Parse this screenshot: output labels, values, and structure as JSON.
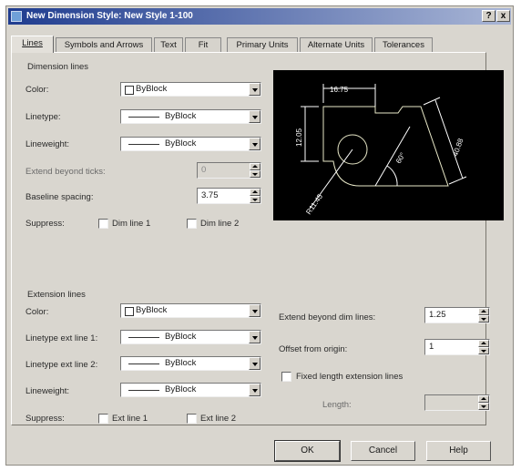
{
  "window": {
    "title": "New Dimension Style: New Style 1-100",
    "help_button": "?",
    "close_button": "x"
  },
  "tabs": [
    {
      "label": "Lines"
    },
    {
      "label": "Symbols and Arrows"
    },
    {
      "label": "Text"
    },
    {
      "label": "Fit"
    },
    {
      "label": "Primary Units"
    },
    {
      "label": "Alternate Units"
    },
    {
      "label": "Tolerances"
    }
  ],
  "dimension_lines": {
    "group_label": "Dimension lines",
    "color": {
      "label": "Color:",
      "value": "ByBlock"
    },
    "linetype": {
      "label": "Linetype:",
      "value": "ByBlock"
    },
    "lineweight": {
      "label": "Lineweight:",
      "value": "ByBlock"
    },
    "extend_beyond_ticks": {
      "label": "Extend beyond ticks:",
      "value": "0"
    },
    "baseline_spacing": {
      "label": "Baseline spacing:",
      "value": "3.75"
    },
    "suppress": {
      "label": "Suppress:",
      "dim_line_1": "Dim line 1",
      "dim_line_2": "Dim line 2"
    }
  },
  "preview": {
    "dims": [
      "16.75",
      "12.05",
      "40.88",
      "60°",
      "R11.45"
    ]
  },
  "extension_lines": {
    "group_label": "Extension lines",
    "color": {
      "label": "Color:",
      "value": "ByBlock"
    },
    "linetype_ext_1": {
      "label": "Linetype ext line 1:",
      "value": "ByBlock"
    },
    "linetype_ext_2": {
      "label": "Linetype ext line 2:",
      "value": "ByBlock"
    },
    "lineweight": {
      "label": "Lineweight:",
      "value": "ByBlock"
    },
    "suppress": {
      "label": "Suppress:",
      "ext_line_1": "Ext line 1",
      "ext_line_2": "Ext line 2"
    },
    "extend_beyond_dim_lines": {
      "label": "Extend beyond dim lines:",
      "value": "1.25"
    },
    "offset_from_origin": {
      "label": "Offset from origin:",
      "value": "1"
    },
    "fixed_length": {
      "label": "Fixed length extension lines"
    },
    "length": {
      "label": "Length:",
      "value": ""
    }
  },
  "buttons": {
    "ok": "OK",
    "cancel": "Cancel",
    "help": "Help"
  },
  "colors": {
    "title_start": "#1f3c8f",
    "preview_bg": "#000000",
    "preview_lines": "#e8e8c8",
    "preview_dims": "#ffffff"
  }
}
